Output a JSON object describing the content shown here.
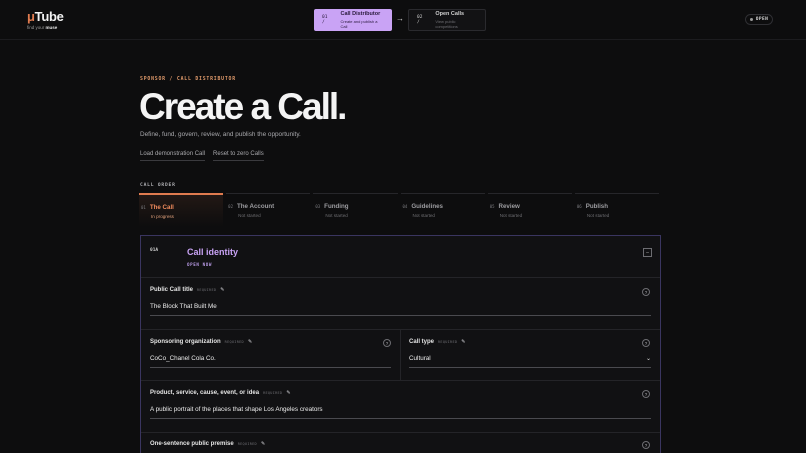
{
  "brand": {
    "name_prefix": "μ",
    "name": "Tube",
    "tagline_prefix": "find your ",
    "tagline_bold": "muse"
  },
  "steps": [
    {
      "num": "01 /",
      "title": "Call Distributor",
      "subtitle": "Create and publish a Call"
    },
    {
      "num": "02 /",
      "title": "Open Calls",
      "subtitle": "View public competitions"
    }
  ],
  "arrow": "→",
  "badge": "OPEN",
  "hero": {
    "eyebrow": "SPONSOR / CALL DISTRIBUTOR",
    "title": "Create a Call.",
    "subtitle": "Define, fund, govern, review, and publish the opportunity.",
    "links": [
      "Load demonstration Call",
      "Reset to zero Calls"
    ]
  },
  "call_order": {
    "label": "CALL ORDER",
    "tabs": [
      {
        "num": "01",
        "label": "The Call",
        "status": "In progress"
      },
      {
        "num": "02",
        "label": "The Account",
        "status": "Not started"
      },
      {
        "num": "03",
        "label": "Funding",
        "status": "Not started"
      },
      {
        "num": "04",
        "label": "Guidelines",
        "status": "Not started"
      },
      {
        "num": "05",
        "label": "Review",
        "status": "Not started"
      },
      {
        "num": "06",
        "label": "Publish",
        "status": "Not started"
      }
    ]
  },
  "card": {
    "kicker": "01A",
    "title": "Call identity",
    "status": "OPEN NOW",
    "collapse": "–",
    "help": "?",
    "pen": "✎",
    "required": "REQUIRED",
    "fields": {
      "title": {
        "label": "Public Call title",
        "value": "The Block That Built Me"
      },
      "sponsor": {
        "label": "Sponsoring organization",
        "value": "CoCo_Chanel Cola Co."
      },
      "type": {
        "label": "Call type",
        "value": "Cultural",
        "chevron": "⌄"
      },
      "product": {
        "label": "Product, service, cause, event, or idea",
        "value": "A public portrait of the places that shape Los Angeles creators"
      },
      "premise": {
        "label": "One-sentence public premise"
      }
    }
  }
}
